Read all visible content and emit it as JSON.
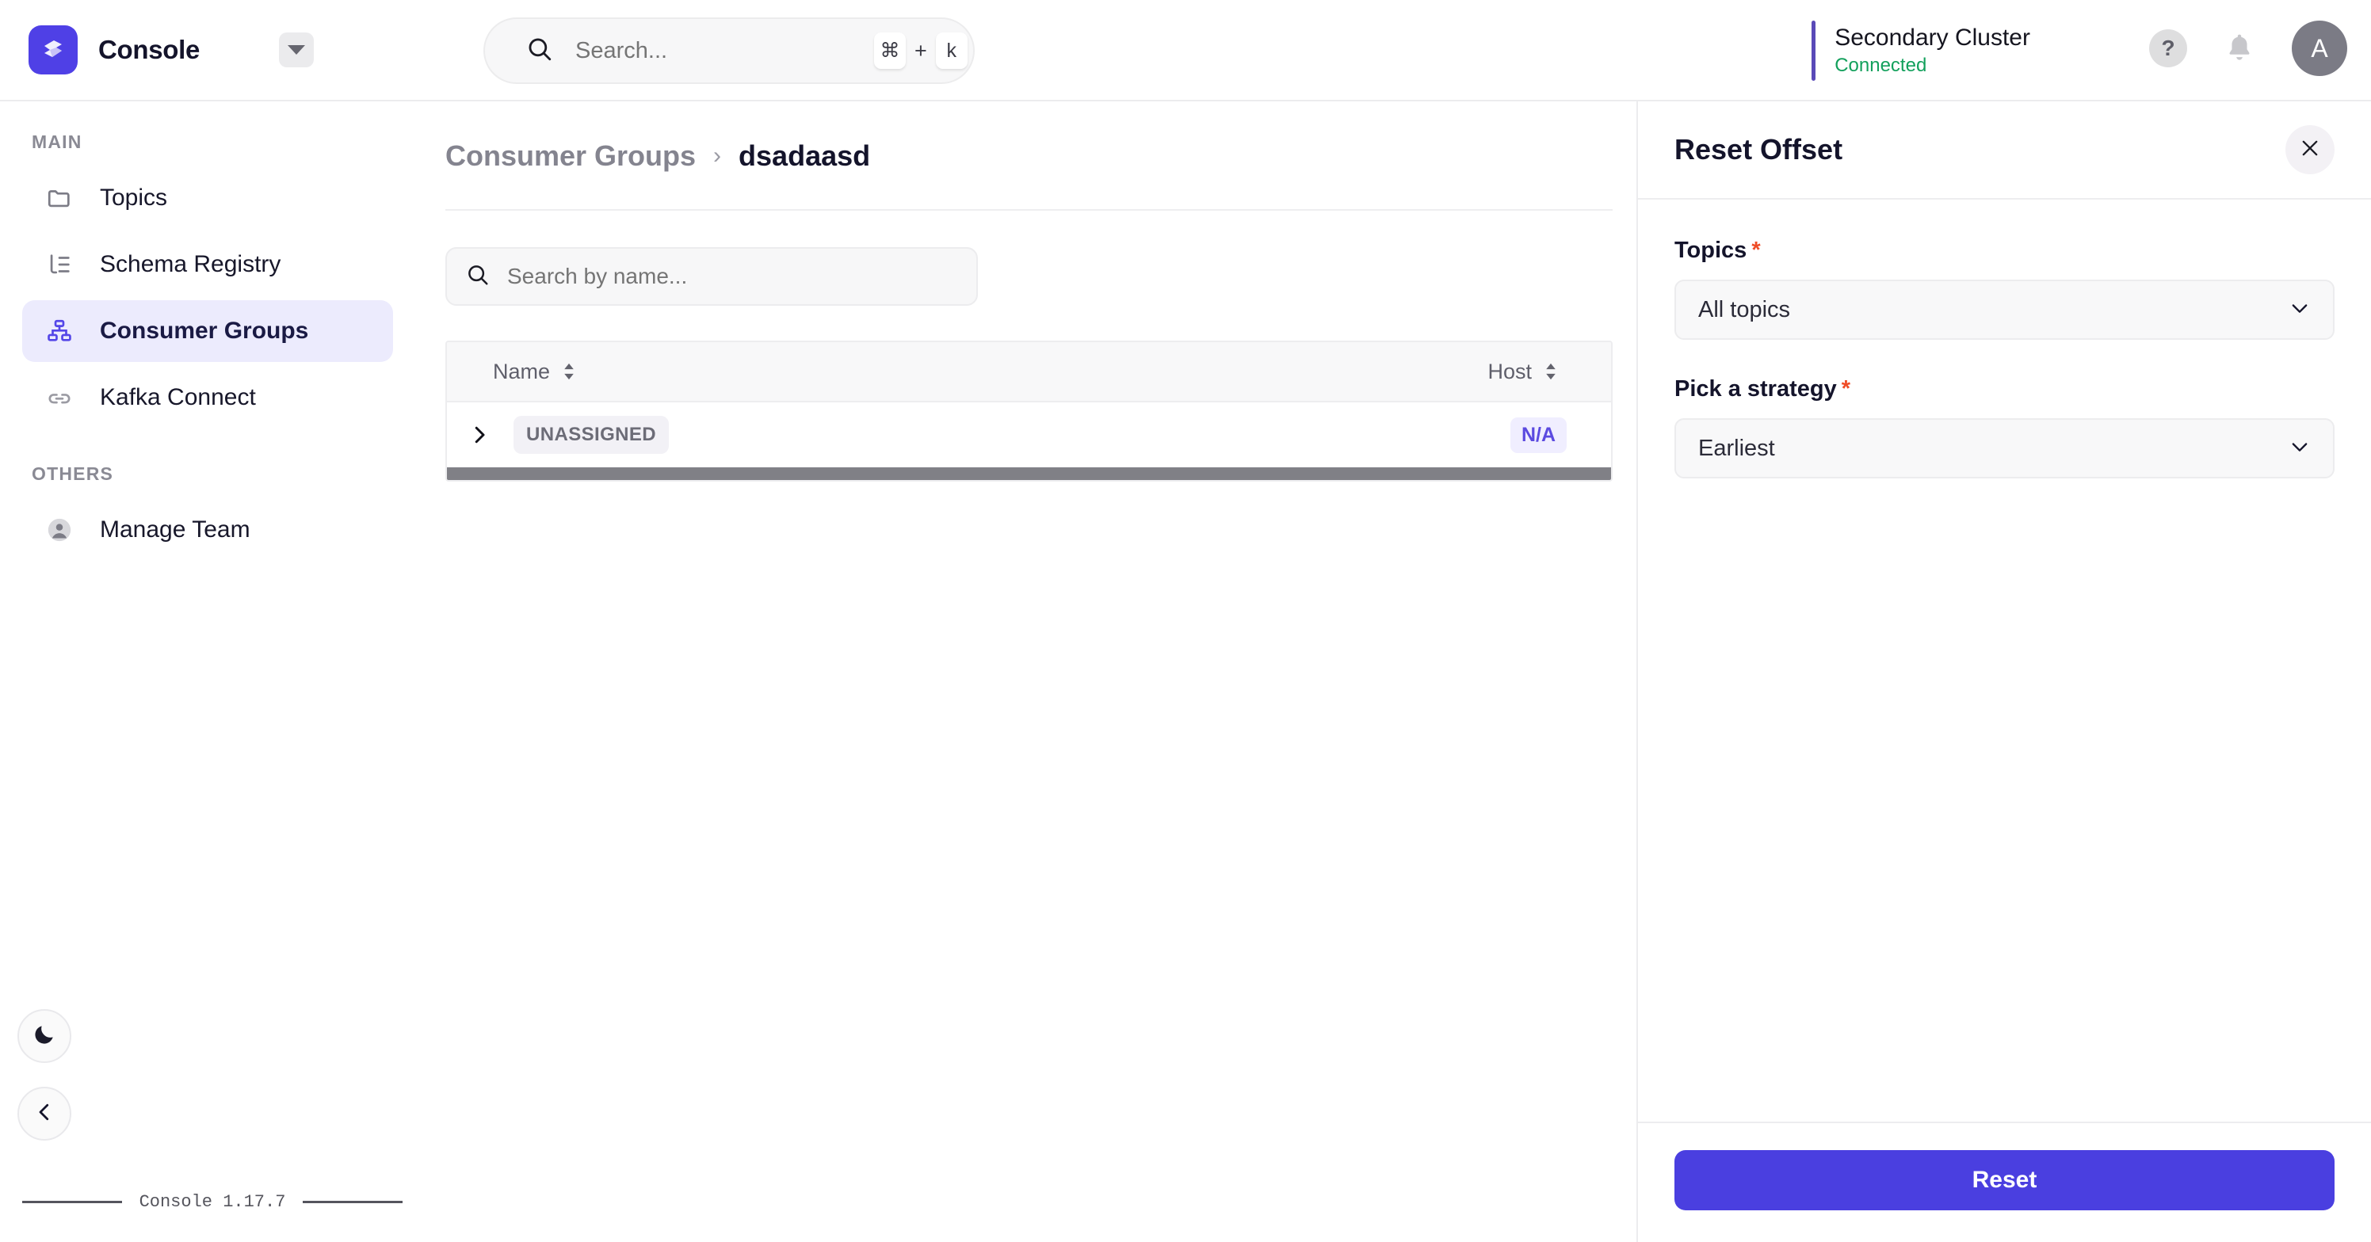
{
  "header": {
    "brand_name": "Console",
    "logo_icon": "console-logo-icon",
    "cluster_dropdown_icon": "chevron-down-icon",
    "search": {
      "placeholder": "Search...",
      "value": "",
      "icon": "search-icon",
      "shortcut_key1": "⌘",
      "shortcut_plus": "+",
      "shortcut_key2": "k"
    },
    "cluster": {
      "name": "Secondary Cluster",
      "status": "Connected",
      "status_color": "#13a05c"
    },
    "help_icon": "question-mark-icon",
    "help_label": "?",
    "notifications_icon": "bell-icon",
    "avatar_initial": "A"
  },
  "sidebar": {
    "sections": [
      {
        "label": "MAIN",
        "items": [
          {
            "label": "Topics",
            "icon": "folder-icon",
            "active": false
          },
          {
            "label": "Schema Registry",
            "icon": "schema-tree-icon",
            "active": false
          },
          {
            "label": "Consumer Groups",
            "icon": "consumer-groups-icon",
            "active": true
          },
          {
            "label": "Kafka Connect",
            "icon": "link-chain-icon",
            "active": false
          }
        ]
      },
      {
        "label": "OTHERS",
        "items": [
          {
            "label": "Manage Team",
            "icon": "user-circle-icon",
            "active": false
          }
        ]
      }
    ],
    "theme_toggle_icon": "moon-icon",
    "collapse_icon": "chevron-left-icon",
    "version": "Console 1.17.7"
  },
  "main": {
    "breadcrumb": {
      "parent": "Consumer Groups",
      "separator": "›",
      "current": "dsadaasd"
    },
    "search": {
      "placeholder": "Search by name...",
      "value": "",
      "icon": "search-icon"
    },
    "table": {
      "columns": [
        {
          "label": "Name",
          "sort_icon": "sort-arrows-icon"
        },
        {
          "label": "Host",
          "sort_icon": "sort-arrows-icon"
        }
      ],
      "rows": [
        {
          "expand_icon": "chevron-right-icon",
          "name_badge": "UNASSIGNED",
          "host_badge": "N/A"
        }
      ]
    }
  },
  "panel": {
    "title": "Reset Offset",
    "close_icon": "close-icon",
    "fields": [
      {
        "label": "Topics",
        "required_mark": "*",
        "value": "All topics",
        "chevron_icon": "chevron-down-icon"
      },
      {
        "label": "Pick a strategy",
        "required_mark": "*",
        "value": "Earliest",
        "chevron_icon": "chevron-down-icon"
      }
    ],
    "submit_label": "Reset",
    "accent_color": "#4a3fe0"
  }
}
